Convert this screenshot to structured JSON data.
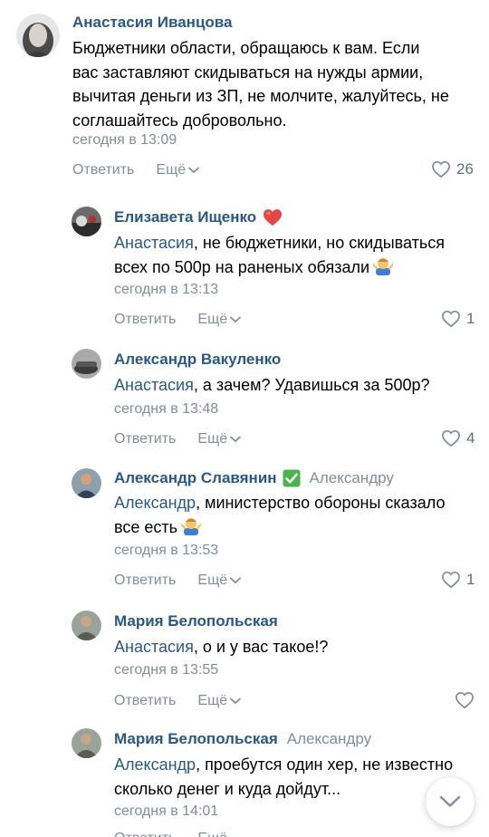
{
  "comments": [
    {
      "author": "Анастасия Иванцова",
      "reply_to": "",
      "mention": "",
      "text_lines": [
        "Бюджетники области, обращаюсь к вам. Если",
        "вас заставляют скидываться на нужды армии,",
        "вычитая деньги из ЗП, не молчите, жалуйтесь, не",
        "соглашайтесь добровольно."
      ],
      "time": "сегодня в 13:09",
      "reply_label": "Ответить",
      "more_label": "Ещё",
      "likes": "26"
    },
    {
      "author": "Елизавета Ищенко",
      "badge": "heart",
      "mention": "Анастасия",
      "text_lines": [
        ", не бюджетники, но скидываться",
        "всех по 500р на раненых обязали"
      ],
      "emoji": "man-shrugging",
      "time": "сегодня в 13:13",
      "reply_label": "Ответить",
      "more_label": "Ещё",
      "likes": "1"
    },
    {
      "author": "Александр Вакуленко",
      "mention": "Анастасия",
      "text_lines": [
        ", а зачем? Удавишься за 500р?"
      ],
      "time": "сегодня в 13:48",
      "reply_label": "Ответить",
      "more_label": "Ещё",
      "likes": "4"
    },
    {
      "author": "Александр Славянин",
      "badge": "check",
      "reply_to": "Александру",
      "mention": "Александр",
      "text_lines": [
        ", министерство обороны сказало",
        "все есть"
      ],
      "emoji": "man-shrugging",
      "time": "сегодня в 13:53",
      "reply_label": "Ответить",
      "more_label": "Ещё",
      "likes": "1"
    },
    {
      "author": "Мария Белопольская",
      "mention": "Анастасия",
      "text_lines": [
        ", о и у вас такое!?"
      ],
      "time": "сегодня в 13:55",
      "reply_label": "Ответить",
      "more_label": "Ещё",
      "likes": ""
    },
    {
      "author": "Мария Белопольская",
      "reply_to": "Александру",
      "mention": "Александр",
      "text_lines": [
        ", проебутся один хер, не известно",
        "сколько денег и куда дойдут..."
      ],
      "time": "сегодня в 14:01",
      "reply_label": "Ответить",
      "more_label": "Ещё",
      "likes": ""
    }
  ],
  "colors": {
    "link": "#2a5885",
    "muted": "#818c99",
    "text": "#000000",
    "heart": "#e64646",
    "check": "#4bb34b"
  },
  "icons": {
    "like": "heart-outline-icon",
    "more": "chevron-down-icon",
    "scroll": "chevron-down-icon"
  }
}
